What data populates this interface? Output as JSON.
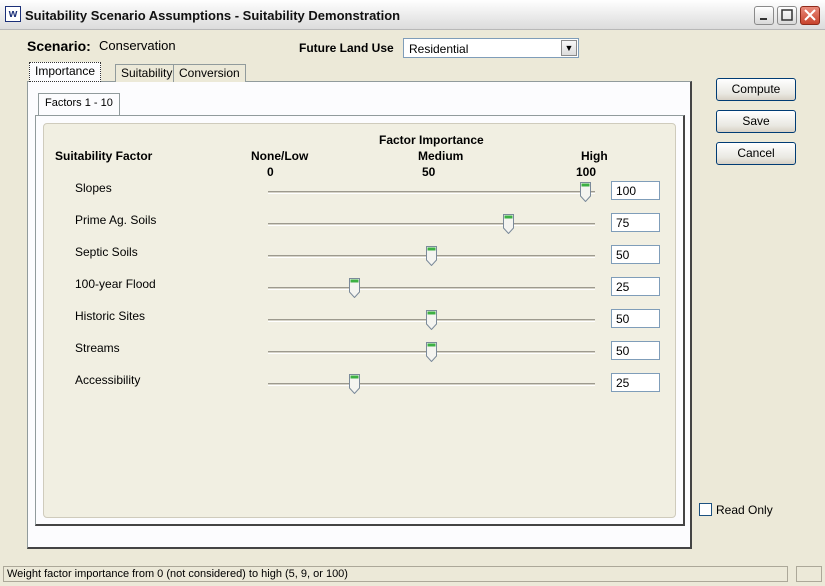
{
  "window": {
    "app_icon": "w",
    "title": "Suitability Scenario Assumptions - Suitability Demonstration"
  },
  "scenario": {
    "label": "Scenario:",
    "value": "Conservation"
  },
  "future_land_use": {
    "label": "Future Land Use",
    "selected": "Residential"
  },
  "tabs": [
    {
      "label": "Importance"
    },
    {
      "label": "Suitability"
    },
    {
      "label": "Conversion"
    }
  ],
  "subtabs": [
    {
      "label": "Factors 1 - 10"
    }
  ],
  "headers": {
    "factor_importance": "Factor Importance",
    "suitability_factor": "Suitability Factor",
    "none_low": "None/Low",
    "medium": "Medium",
    "high": "High",
    "scale_min": "0",
    "scale_mid": "50",
    "scale_max": "100"
  },
  "factors": [
    {
      "label": "Slopes",
      "value": "100"
    },
    {
      "label": "Prime Ag. Soils",
      "value": "75"
    },
    {
      "label": "Septic Soils",
      "value": "50"
    },
    {
      "label": "100-year Flood",
      "value": "25"
    },
    {
      "label": "Historic Sites",
      "value": "50"
    },
    {
      "label": "Streams",
      "value": "50"
    },
    {
      "label": "Accessibility",
      "value": "25"
    }
  ],
  "buttons": {
    "compute": "Compute",
    "save": "Save",
    "cancel": "Cancel"
  },
  "read_only": {
    "label": "Read Only",
    "checked": false
  },
  "status": "Weight factor importance from 0 (not considered) to high (5, 9, or 100)",
  "colors": {
    "thumb_green": "#3cb043",
    "titlebar": "#e9e9e9",
    "close_red": "#c8432c"
  }
}
